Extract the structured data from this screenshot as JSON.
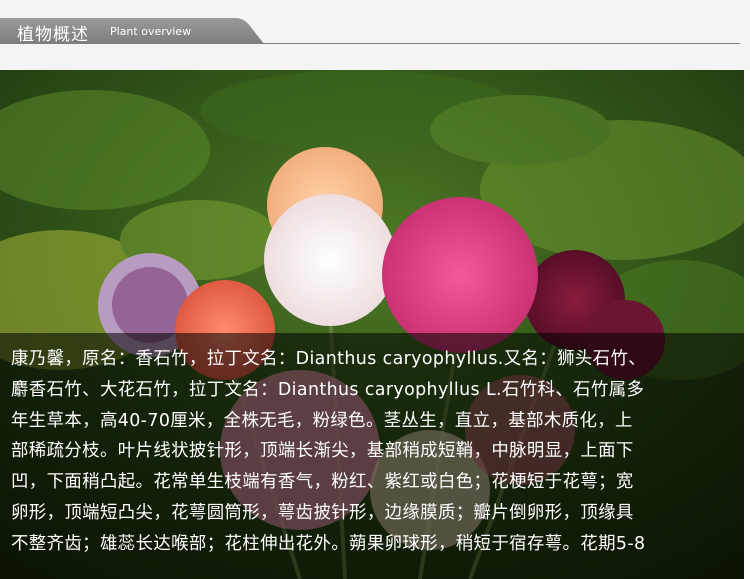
{
  "section": {
    "title_cn": "植物概述",
    "title_en": "Plant overview"
  },
  "photo": {
    "subject": "carnation-bouquet-image"
  },
  "description": {
    "lines": [
      "康乃馨，原名：香石竹，拉丁文名：Dianthus caryophyllus.又名：狮头石竹、",
      "麝香石竹、大花石竹，拉丁文名：Dianthus caryophyllus L.石竹科、石竹属多",
      "年生草本，高40-70厘米，全株无毛，粉绿色。茎丛生，直立，基部木质化，上",
      "部稀疏分枝。叶片线状披针形，顶端长渐尖，基部稍成短鞘，中脉明显，上面下",
      "凹，下面稍凸起。花常单生枝端有香气，粉红、紫红或白色；花梗短于花萼；宽",
      "卵形，顶端短凸尖，花萼圆筒形，萼齿披针形，边缘膜质；瓣片倒卵形，顶缘具",
      "不整齐齿；雄蕊长达喉部；花柱伸出花外。蒴果卵球形，稍短于宿存萼。花期5-8"
    ]
  },
  "colors": {
    "tab_bg": "#8a8a8a",
    "overlay": "rgba(0,0,0,0.55)",
    "text": "#ffffff"
  }
}
